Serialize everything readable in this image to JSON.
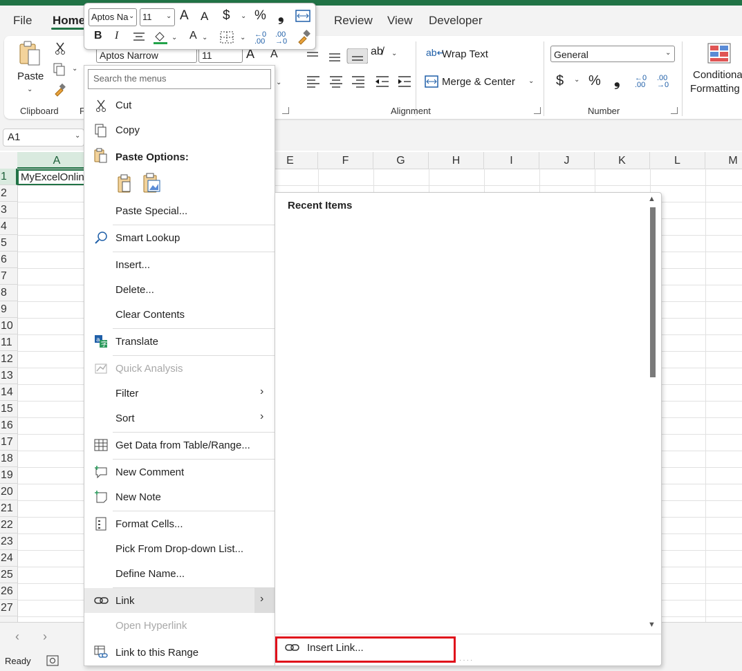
{
  "ribbon_tabs": [
    "File",
    "Home",
    "Review",
    "View",
    "Developer"
  ],
  "ribbon": {
    "clipboard": {
      "paste_label": "Paste",
      "group_label": "Clipboard"
    },
    "font": {
      "name": "Aptos Narrow",
      "size": "11",
      "group_label_partial": "F"
    },
    "alignment": {
      "wrap_text": "Wrap Text",
      "merge_center": "Merge & Center",
      "group_label": "Alignment"
    },
    "number": {
      "format": "General",
      "currency": "$",
      "percent": "%",
      "comma": "❟",
      "group_label": "Number"
    },
    "styles": {
      "conditional_line1": "Conditional",
      "conditional_line2": "Formatting"
    }
  },
  "mini_toolbar": {
    "font": "Aptos Na",
    "size": "11",
    "dollar": "$",
    "percent": "%",
    "comma": "❟",
    "bold": "B",
    "italic": "I",
    "increase_font": "A",
    "decrease_font": "A",
    "font_color": "A"
  },
  "name_box": "A1",
  "columns": [
    "A",
    "E",
    "F",
    "G",
    "H",
    "I",
    "J",
    "K",
    "L",
    "M"
  ],
  "rows": [
    "1",
    "2",
    "3",
    "4",
    "5",
    "6",
    "7",
    "8",
    "9",
    "10",
    "11",
    "12",
    "13",
    "14",
    "15",
    "16",
    "17",
    "18",
    "19",
    "20",
    "21",
    "22",
    "23",
    "24",
    "25",
    "26",
    "27"
  ],
  "cell_a1": "MyExcelOnline",
  "status": {
    "ready": "Ready"
  },
  "context_menu": {
    "search_placeholder": "Search the menus",
    "cut": "Cut",
    "copy": "Copy",
    "paste_options": "Paste Options:",
    "paste_special": "Paste Special...",
    "smart_lookup": "Smart Lookup",
    "insert": "Insert...",
    "delete": "Delete...",
    "clear_contents": "Clear Contents",
    "translate": "Translate",
    "quick_analysis": "Quick Analysis",
    "filter": "Filter",
    "sort": "Sort",
    "get_data": "Get Data from Table/Range...",
    "new_comment": "New Comment",
    "new_note": "New Note",
    "format_cells": "Format Cells...",
    "pick_dropdown": "Pick From Drop-down List...",
    "define_name": "Define Name...",
    "link": "Link",
    "open_hyperlink": "Open Hyperlink",
    "link_to_range": "Link to this Range"
  },
  "submenu": {
    "title": "Recent Items",
    "insert_link": "Insert Link..."
  },
  "colors": {
    "brand": "#217346",
    "highlight_box": "#e0101b"
  }
}
